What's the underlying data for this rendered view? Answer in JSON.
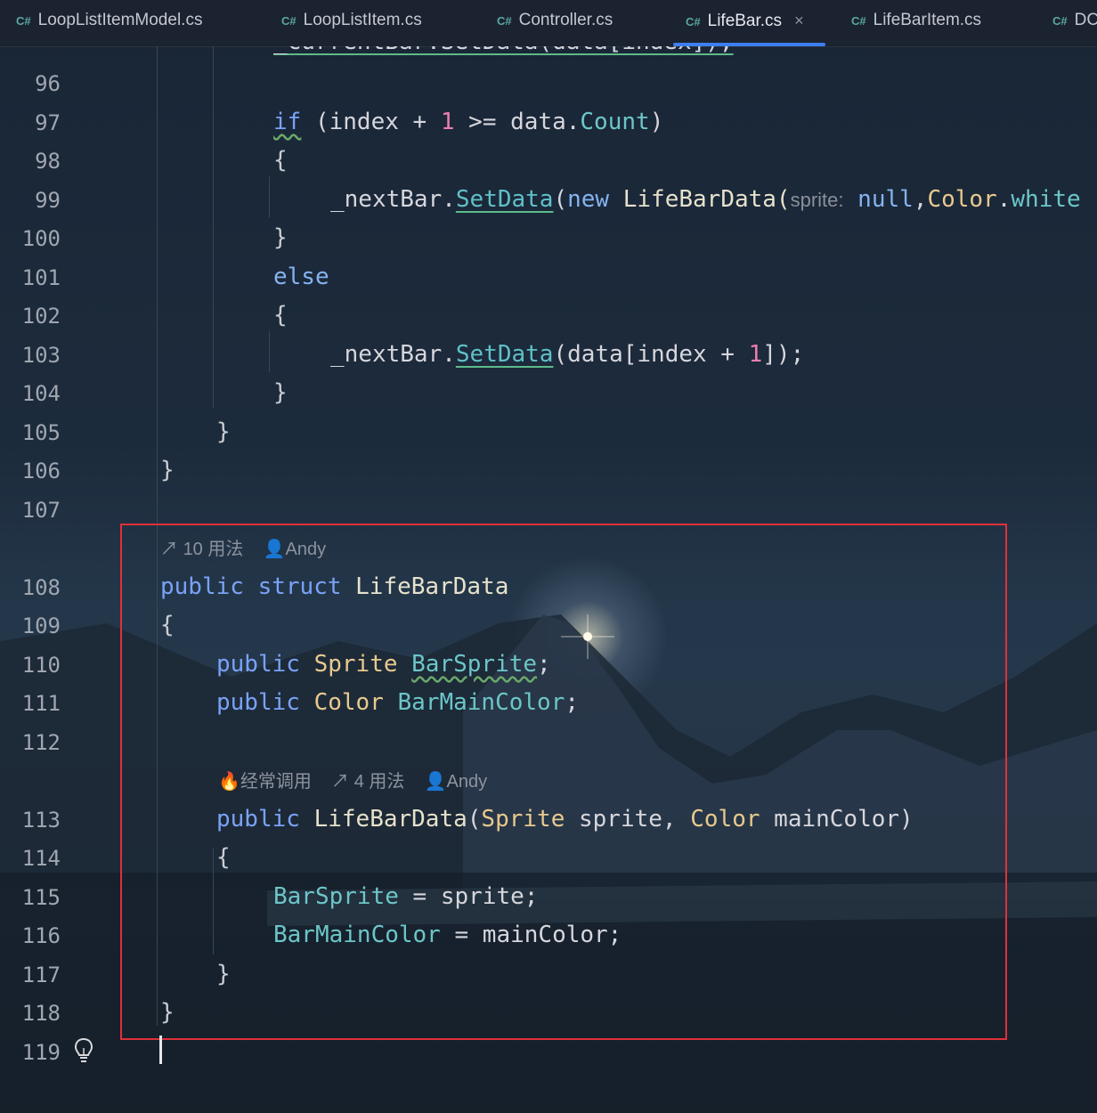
{
  "tabs": [
    {
      "lang": "C#",
      "label": "LoopListItemModel.cs"
    },
    {
      "lang": "C#",
      "label": "LoopListItem.cs"
    },
    {
      "lang": "C#",
      "label": "Controller.cs"
    },
    {
      "lang": "C#",
      "label": "LifeBar.cs",
      "active": true,
      "close": "×"
    },
    {
      "lang": "C#",
      "label": "LifeBarItem.cs"
    },
    {
      "lang": "C#",
      "label": "DC"
    }
  ],
  "line_numbers": [
    "96",
    "97",
    "98",
    "99",
    "100",
    "101",
    "102",
    "103",
    "104",
    "105",
    "106",
    "107",
    "108",
    "109",
    "110",
    "111",
    "112",
    "113",
    "114",
    "115",
    "116",
    "117",
    "118",
    "119"
  ],
  "code": {
    "l95_partial": "_currentBar.SetData(data[index]);",
    "l97": {
      "kw": "if",
      "pre": " (index + ",
      "num": "1",
      "mid": " >= data.",
      "mem": "Count",
      "end": ")"
    },
    "l98": "{",
    "l99": {
      "obj": "_nextBar",
      "dot": ".",
      "fn": "SetData",
      "open": "(",
      "kw": "new",
      "type": " LifeBarData(",
      "hint": "sprite:",
      "null": " null",
      "comma": ",",
      "color": "Color",
      "dot2": ".",
      "white": "white"
    },
    "l100": "}",
    "l101": "else",
    "l102": "{",
    "l103": {
      "obj": "_nextBar",
      "dot": ".",
      "fn": "SetData",
      "args": "(data[index + ",
      "num": "1",
      "end": "]);"
    },
    "l104": "}",
    "l105": "}",
    "l106": "}",
    "inlay_108": {
      "usages": "10 用法",
      "author": "Andy"
    },
    "l108": {
      "kw1": "public",
      "kw2": "struct",
      "name": "LifeBarData"
    },
    "l109": "{",
    "l110": {
      "kw": "public",
      "type": "Sprite",
      "field": "BarSprite",
      "end": ";"
    },
    "l111": {
      "kw": "public",
      "type": "Color",
      "field": "BarMainColor",
      "end": ";"
    },
    "inlay_113": {
      "hot": "经常调用",
      "usages": "4 用法",
      "author": "Andy"
    },
    "l113": {
      "kw": "public",
      "name": "LifeBarData",
      "open": "(",
      "t1": "Sprite",
      "p1": " sprite, ",
      "t2": "Color",
      "p2": " mainColor)"
    },
    "l114": "{",
    "l115": {
      "field": "BarSprite",
      "rest": " = sprite;"
    },
    "l116": {
      "field": "BarMainColor",
      "rest": " = mainColor;"
    },
    "l117": "}",
    "l118": "}"
  },
  "colors": {
    "highlight_box": "#e0303a",
    "active_tab_indicator": "#3d7ef0"
  }
}
